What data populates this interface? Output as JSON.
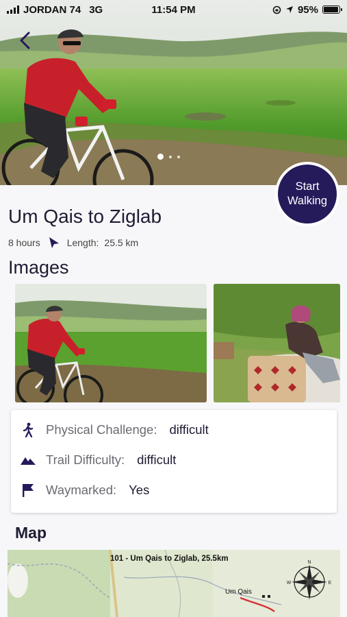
{
  "status_bar": {
    "carrier": "JORDAN 74",
    "network": "3G",
    "time": "11:54 PM",
    "battery": "95%",
    "battery_level": 0.95
  },
  "trail": {
    "title": "Um Qais to Ziglab",
    "duration": "8 hours",
    "length_label": "Length:",
    "length_value": "25.5 km"
  },
  "start_button": {
    "line1": "Start",
    "line2": "Walking"
  },
  "carousel": {
    "count": 3,
    "active_index": 0
  },
  "images_heading": "Images",
  "info": [
    {
      "icon": "walking-person-icon",
      "label": "Physical Challenge:",
      "value": "difficult"
    },
    {
      "icon": "mountain-icon",
      "label": "Trail Difficulty:",
      "value": "difficult"
    },
    {
      "icon": "flag-icon",
      "label": "Waymarked:",
      "value": "Yes"
    }
  ],
  "map": {
    "heading": "Map",
    "caption": "101 - Um Qais to Ziglab, 25.5km",
    "town_label": "Um Qais"
  },
  "colors": {
    "accent": "#251a5a",
    "background": "#f7f7f9",
    "label_gray": "#6a6a72"
  }
}
